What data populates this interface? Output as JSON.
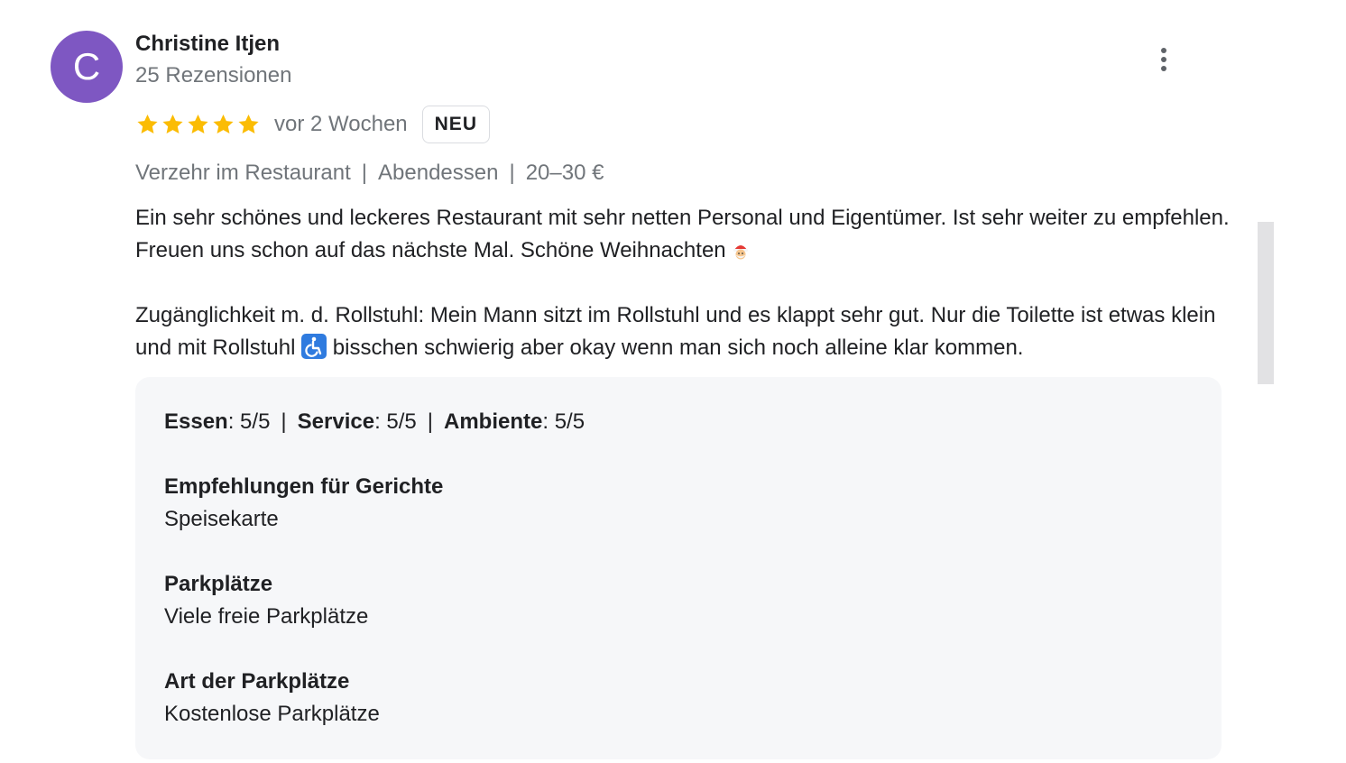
{
  "author": {
    "initial": "C",
    "name": "Christine Itjen",
    "review_count": "25 Rezensionen",
    "avatar_color": "#7e57c2"
  },
  "rating": {
    "stars": 5,
    "max_stars": 5,
    "star_color": "#fbbc04",
    "time": "vor 2 Wochen",
    "badge": "NEU"
  },
  "meta": {
    "service_type": "Verzehr im Restaurant",
    "meal_type": "Abendessen",
    "price": "20–30 €",
    "separator": "|"
  },
  "review": {
    "paragraph1": "Ein sehr schönes und leckeres Restaurant mit sehr netten Personal und Eigentümer.  Ist sehr weiter zu empfehlen.  Freuen uns schon auf das nächste Mal. Schöne Weihnachten",
    "paragraph1_emoji": "santa-emoji",
    "paragraph2_start": "Zugänglichkeit m. d. Rollstuhl: Mein Mann sitzt im Rollstuhl und es klappt sehr gut.  Nur die Toilette ist etwas klein und mit Rollstuhl",
    "paragraph2_emoji": "wheelchair-emoji",
    "paragraph2_end": "bisschen schwierig aber okay wenn man sich noch alleine klar kommen."
  },
  "details": {
    "scores": [
      {
        "label": "Essen",
        "value": ": 5/5"
      },
      {
        "label": "Service",
        "value": ": 5/5"
      },
      {
        "label": "Ambiente",
        "value": ": 5/5"
      }
    ],
    "separator": "|",
    "sections": [
      {
        "label": "Empfehlungen für Gerichte",
        "value": "Speisekarte"
      },
      {
        "label": "Parkplätze",
        "value": "Viele freie Parkplätze"
      },
      {
        "label": "Art der Parkplätze",
        "value": "Kostenlose Parkplätze"
      }
    ]
  },
  "icons": {
    "more": "more-vert-icon",
    "star": "star-icon"
  }
}
